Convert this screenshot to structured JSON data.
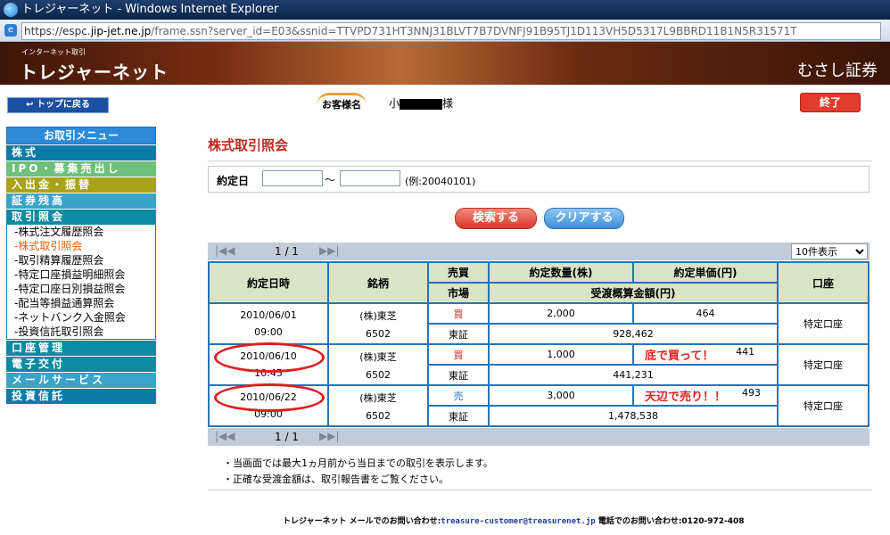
{
  "window": {
    "title": "トレジャーネット - Windows Internet Explorer"
  },
  "address": {
    "url_domain_prefix": "https://espc.",
    "url_domain": "jip-jet.ne.jp",
    "url_rest": "/frame.ssn?server_id=E03&ssnid=TTVPD731HT3NNJ31BLVT7B7DVNFJ91B95TJ1D113VH5D5317L9BBRD11B1N5R31571T"
  },
  "banner": {
    "small": "インターネット取引",
    "logo": "トレジャーネット",
    "company": "むさし証券"
  },
  "header": {
    "top_button": "トップに戻る",
    "customer_label": "お客様名",
    "customer_initial": "小",
    "customer_suffix": "様",
    "end_button": "終了"
  },
  "sidebar": {
    "title": "お取引メニュー",
    "categories": [
      {
        "label": "株式",
        "color": "#0c7ba8"
      },
      {
        "label": "IPO・募集売出し",
        "color": "#6ec07a"
      },
      {
        "label": "入出金・振替",
        "color": "#a9a31a"
      },
      {
        "label": "証券残高",
        "color": "#3aa3c9"
      },
      {
        "label": "取引照会",
        "color": "#0e8aa2"
      }
    ],
    "subitems": [
      "-株式注文履歴照会",
      "-株式取引照会",
      "-取引精算履歴照会",
      "-特定口座損益明細照会",
      "-特定口座日別損益照会",
      "-配当等損益通算照会",
      "-ネットバンク入金照会",
      "-投資信託取引照会"
    ],
    "bottom_categories": [
      {
        "label": "口座管理",
        "color": "#0e8aa2"
      },
      {
        "label": "電子交付",
        "color": "#0e8aa2"
      },
      {
        "label": "メールサービス",
        "color": "#3aa3c9"
      },
      {
        "label": "投資信託",
        "color": "#0c7ba8"
      }
    ]
  },
  "main": {
    "title": "株式取引照会",
    "search_label": "約定日",
    "date_from": "",
    "date_to": "",
    "tilde": "〜",
    "example": "(例:20040101)",
    "search_button": "検索する",
    "clear_button": "クリアする",
    "pager": {
      "text": "1 / 1",
      "first": "|◀◀",
      "prev": "",
      "next": "▶",
      "last": "▶|",
      "per_page": "10件表示"
    }
  },
  "table": {
    "headers": {
      "date": "約定日時",
      "issue": "銘柄",
      "side": "売買",
      "market": "市場",
      "qty": "約定数量(株)",
      "price": "約定単価(円)",
      "amount": "受渡概算金額(円)",
      "account": "口座"
    },
    "rows": [
      {
        "date": "2010/06/01",
        "time": "09:00",
        "issue": "(株)東芝",
        "code": "6502",
        "side": "買",
        "side_type": "buy",
        "market": "東証",
        "qty": "2,000",
        "price": "464",
        "amount": "928,462",
        "account": "特定口座",
        "annotation": ""
      },
      {
        "date": "2010/06/10",
        "time": "10:45",
        "issue": "(株)東芝",
        "code": "6502",
        "side": "買",
        "side_type": "buy",
        "market": "東証",
        "qty": "1,000",
        "price": "441",
        "amount": "441,231",
        "account": "特定口座",
        "annotation": "底で買って！"
      },
      {
        "date": "2010/06/22",
        "time": "09:00",
        "issue": "(株)東芝",
        "code": "6502",
        "side": "売",
        "side_type": "sell",
        "market": "東証",
        "qty": "3,000",
        "price": "493",
        "amount": "1,478,538",
        "account": "特定口座",
        "annotation": "天辺で売り！！"
      }
    ]
  },
  "notes": [
    "・当画面では最大1ヵ月前から当日までの取引を表示します。",
    "・正確な受渡金額は、取引報告書をご覧ください。"
  ],
  "footer": {
    "prefix": "トレジャーネット メールでのお問い合わせ:",
    "email": "treasure-customer@treasurenet.jp",
    "phone": " 電話でのお問い合わせ:0120-972-408"
  }
}
